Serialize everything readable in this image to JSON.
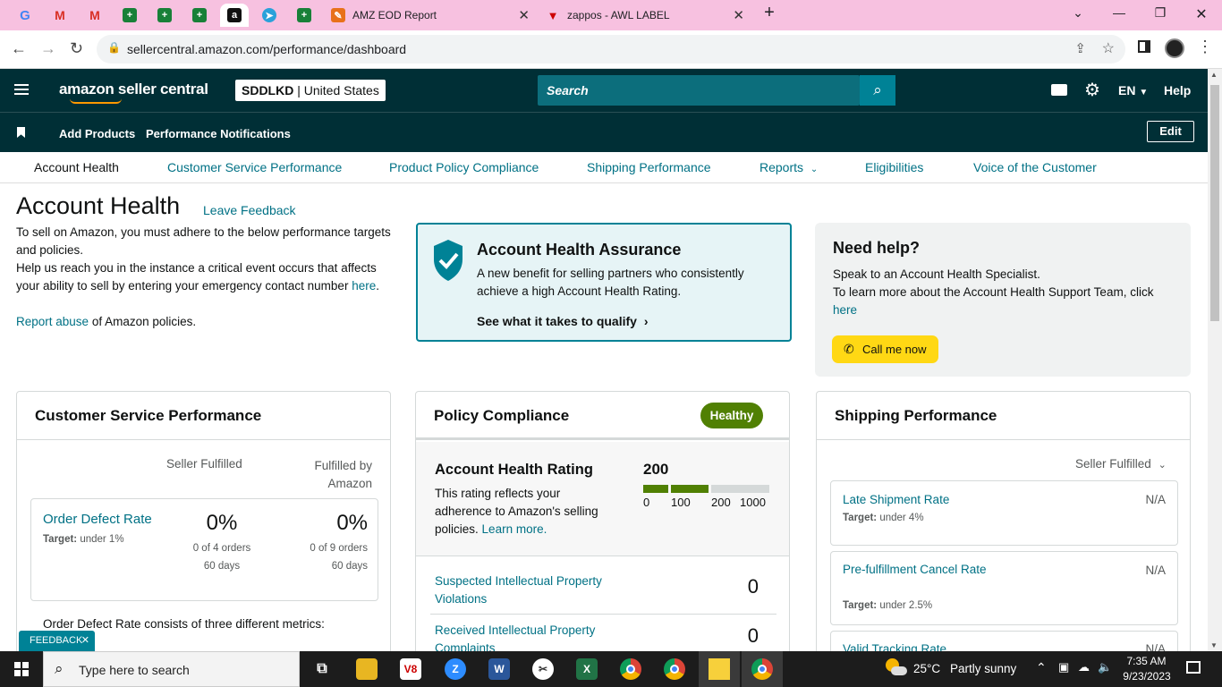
{
  "browser": {
    "tabs": [
      {
        "title": "AMZ EOD Report"
      },
      {
        "title": "zappos - AWL LABEL"
      }
    ],
    "url": "sellercentral.amazon.com/performance/dashboard"
  },
  "header": {
    "logo": "amazon seller central",
    "store": "SDDLKD",
    "marketplace": "United States",
    "search_placeholder": "Search",
    "lang": "EN",
    "help": "Help"
  },
  "nav2": {
    "items": [
      "Add Products",
      "Performance Notifications"
    ],
    "edit": "Edit"
  },
  "nav3": {
    "items": [
      "Account Health",
      "Customer Service Performance",
      "Product Policy Compliance",
      "Shipping Performance",
      "Reports",
      "Eligibilities",
      "Voice of the Customer"
    ]
  },
  "page": {
    "title": "Account Health",
    "leave_feedback": "Leave Feedback",
    "intro1": "To sell on Amazon, you must adhere to the below performance targets and policies.",
    "intro2": "Help us reach you in the instance a critical event occurs that affects your ability to sell by entering your emergency contact number",
    "here": "here",
    "report_abuse": "Report abuse",
    "report_rest": "of Amazon policies."
  },
  "assurance": {
    "title": "Account Health Assurance",
    "body": "A new benefit for selling partners who consistently achieve a high Account Health Rating.",
    "cta": "See what it takes to qualify"
  },
  "help": {
    "title": "Need help?",
    "line1": "Speak to an Account Health Specialist.",
    "line2": "To learn more about the Account Health Support Team, click",
    "here": "here",
    "call": "Call me now"
  },
  "csp": {
    "title": "Customer Service Performance",
    "col1": "Seller Fulfilled",
    "col2": "Fulfilled by Amazon",
    "metric": "Order Defect Rate",
    "target_label": "Target:",
    "target": "under 1%",
    "v1": "0%",
    "v1_sub": "0 of 4 orders",
    "v1_days": "60 days",
    "v2": "0%",
    "v2_sub": "0 of 9 orders",
    "v2_days": "60 days",
    "footer": "Order Defect Rate consists of three different metrics:"
  },
  "policy": {
    "title": "Policy Compliance",
    "badge": "Healthy",
    "ahr_title": "Account Health Rating",
    "ahr_value": "200",
    "ahr_level": 0.2,
    "ahr_body": "This rating reflects your adherence to Amazon's selling policies.",
    "learn_more": "Learn more.",
    "scale": [
      "0",
      "100",
      "200",
      "1000"
    ],
    "rows": [
      {
        "label": "Suspected Intellectual Property Violations",
        "value": "0"
      },
      {
        "label": "Received Intellectual Property Complaints",
        "value": "0"
      }
    ]
  },
  "shipping": {
    "title": "Shipping Performance",
    "filter": "Seller Fulfilled",
    "rows": [
      {
        "label": "Late Shipment Rate",
        "value": "N/A",
        "target_label": "Target:",
        "target": "under 4%"
      },
      {
        "label": "Pre-fulfillment Cancel Rate",
        "value": "N/A",
        "target_label": "Target:",
        "target": "under 2.5%"
      },
      {
        "label": "Valid Tracking Rate",
        "value": "N/A"
      }
    ]
  },
  "feedback": "FEEDBACK",
  "taskbar": {
    "search": "Type here to search",
    "weather_temp": "25°C",
    "weather_desc": "Partly sunny",
    "time": "7:35 AM",
    "date": "9/23/2023"
  },
  "colors": {
    "teal": "#002f36",
    "link": "#007185",
    "healthy": "#508003",
    "yellow": "#ffd814"
  }
}
